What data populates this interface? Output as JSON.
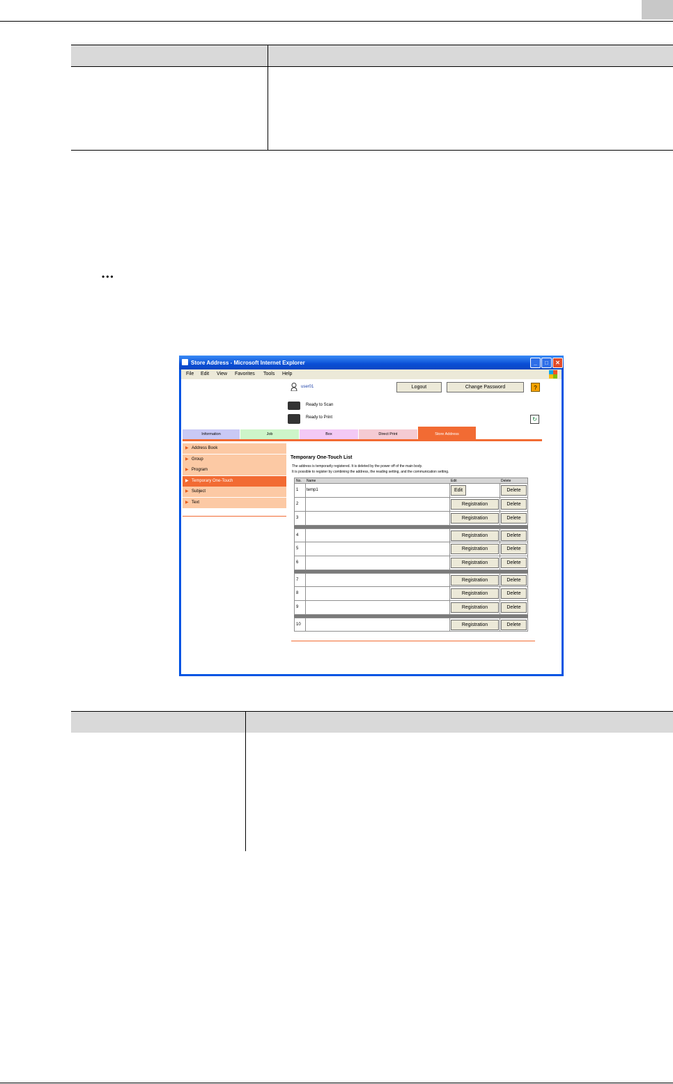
{
  "browser": {
    "title": "Store Address - Microsoft Internet Explorer",
    "menu": [
      "File",
      "Edit",
      "View",
      "Favorites",
      "Tools",
      "Help"
    ]
  },
  "header": {
    "user": "user01",
    "logout": "Logout",
    "change_password": "Change Password",
    "help": "?",
    "status_scan": "Ready to Scan",
    "status_print": "Ready to Print"
  },
  "tabs": [
    {
      "label": "Information",
      "color": "#c9c9f5"
    },
    {
      "label": "Job",
      "color": "#cdf5c9"
    },
    {
      "label": "Box",
      "color": "#f3c9f5"
    },
    {
      "label": "Direct Print",
      "color": "#f5cbd3"
    },
    {
      "label": "Store Address",
      "color": "#f26b33"
    }
  ],
  "sidebar": [
    {
      "label": "Address Book",
      "active": false
    },
    {
      "label": "Group",
      "active": false
    },
    {
      "label": "Program",
      "active": false
    },
    {
      "label": "Temporary One-Touch",
      "active": true
    },
    {
      "label": "Subject",
      "active": false
    },
    {
      "label": "Text",
      "active": false
    }
  ],
  "main": {
    "title": "Temporary One-Touch List",
    "desc1": "The address is temporarily registered. It is deleted by the power off of the main body.",
    "desc2": "It is possible to register by combining the address, the reading setting, and the communication setting.",
    "col_no": "No.",
    "col_name": "Name",
    "col_edit": "Edit",
    "col_delete": "Delete",
    "rows": [
      {
        "no": "1",
        "name": "temp1",
        "action": "Edit",
        "delete": "Delete"
      },
      {
        "no": "2",
        "name": "",
        "action": "Registration",
        "delete": "Delete"
      },
      {
        "no": "3",
        "name": "",
        "action": "Registration",
        "delete": "Delete"
      },
      {
        "no": "4",
        "name": "",
        "action": "Registration",
        "delete": "Delete"
      },
      {
        "no": "5",
        "name": "",
        "action": "Registration",
        "delete": "Delete"
      },
      {
        "no": "6",
        "name": "",
        "action": "Registration",
        "delete": "Delete"
      },
      {
        "no": "7",
        "name": "",
        "action": "Registration",
        "delete": "Delete"
      },
      {
        "no": "8",
        "name": "",
        "action": "Registration",
        "delete": "Delete"
      },
      {
        "no": "9",
        "name": "",
        "action": "Registration",
        "delete": "Delete"
      },
      {
        "no": "10",
        "name": "",
        "action": "Registration",
        "delete": "Delete"
      }
    ]
  },
  "accent": "#f26b33"
}
